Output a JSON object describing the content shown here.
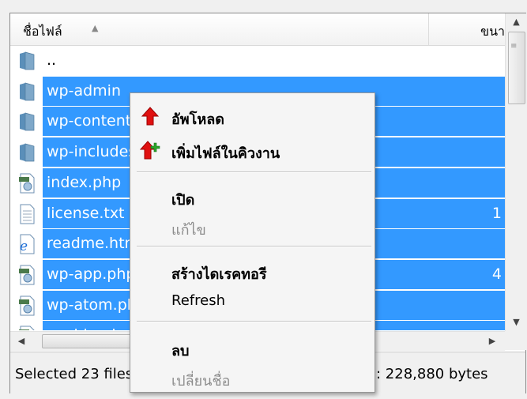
{
  "header": {
    "name_label": "ชื่อไฟล์",
    "sort_indicator": "▲",
    "size_label": "ขนา"
  },
  "files": [
    {
      "name": "..",
      "icon": "folder-icon",
      "size": "",
      "selected": false
    },
    {
      "name": "wp-admin",
      "icon": "folder-icon",
      "size": "",
      "selected": true
    },
    {
      "name": "wp-content",
      "icon": "folder-icon",
      "size": "",
      "selected": true
    },
    {
      "name": "wp-includes",
      "icon": "folder-icon",
      "size": "",
      "selected": true
    },
    {
      "name": "index.php",
      "icon": "php-file-icon",
      "size": "",
      "selected": true
    },
    {
      "name": "license.txt",
      "icon": "text-file-icon",
      "size": "1",
      "selected": true
    },
    {
      "name": "readme.html",
      "icon": "html-file-icon",
      "size": "",
      "selected": true
    },
    {
      "name": "wp-app.php",
      "icon": "php-file-icon",
      "size": "4",
      "selected": true
    },
    {
      "name": "wp-atom.php",
      "icon": "php-file-icon",
      "size": "",
      "selected": true
    },
    {
      "name": "wp-blog-header.php",
      "icon": "php-file-icon",
      "size": "",
      "selected": true
    }
  ],
  "status": {
    "selected_text": "Selected 23 files",
    "total_text": ": 228,880 bytes"
  },
  "context_menu": {
    "upload": "อัพโหลด",
    "add_to_queue": "เพิ่มไฟล์ในคิวงาน",
    "open": "เปิด",
    "edit": "แก้ไข",
    "create_directory": "สร้างไดเรคทอรี",
    "refresh": "Refresh",
    "delete": "ลบ",
    "rename": "เปลี่ยนชื่อ"
  },
  "colors": {
    "selection": "#3399ff",
    "upload_arrow": "#e01010",
    "queue_plus": "#2aa52a"
  }
}
